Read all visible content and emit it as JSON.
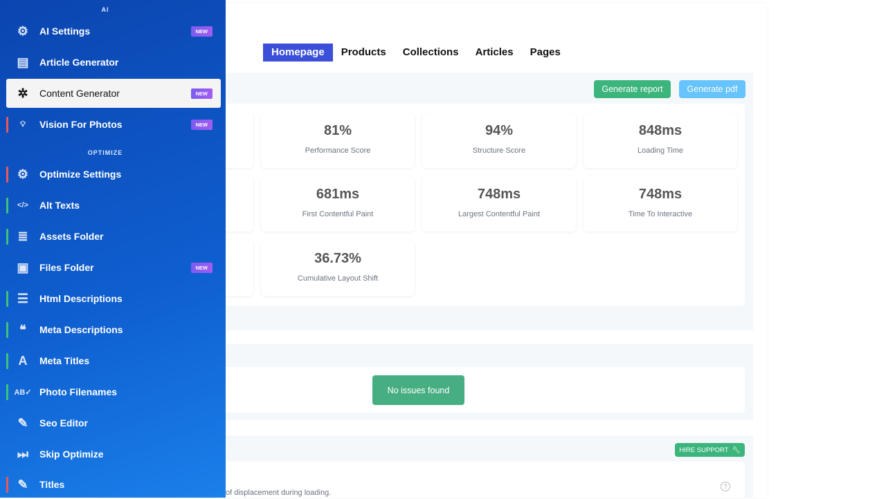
{
  "tabs": [
    {
      "label": "Homepage",
      "active": true
    },
    {
      "label": "Products"
    },
    {
      "label": "Collections"
    },
    {
      "label": "Articles"
    },
    {
      "label": "Pages"
    }
  ],
  "actions": {
    "generate_report": "Generate report",
    "generate_pdf": "Generate pdf"
  },
  "metrics": [
    {
      "value": "81%",
      "label": "Performance Score"
    },
    {
      "value": "94%",
      "label": "Structure Score"
    },
    {
      "value": "848ms",
      "label": "Loading Time"
    },
    {
      "value": "681ms",
      "label": "First Contentful Paint"
    },
    {
      "value": "748ms",
      "label": "Largest Contentful Paint"
    },
    {
      "value": "748ms",
      "label": "Time To Interactive"
    },
    {
      "value": "36.73%",
      "label": "Cumulative Layout Shift"
    }
  ],
  "issues": {
    "status": "No issues found"
  },
  "support": {
    "hire_label": "HIRE SUPPORT",
    "description_fragment": "of displacement during loading.",
    "help": "?"
  },
  "sidebar": {
    "section_ai": "AI",
    "section_optimize": "OPTIMIZE",
    "badge": "NEW",
    "items": [
      {
        "label": "AI Settings",
        "icon": "brain-gear-icon",
        "new": true
      },
      {
        "label": "Article Generator",
        "icon": "newspaper-icon"
      },
      {
        "label": "Content Generator",
        "icon": "network-icon",
        "new": true,
        "active": true
      },
      {
        "label": "Vision For Photos",
        "icon": "lightbulb-icon",
        "new": true,
        "marker": "#e85a5a"
      },
      {
        "label": "Optimize Settings",
        "icon": "cogs-icon",
        "marker": "#e85a5a"
      },
      {
        "label": "Alt Texts",
        "icon": "code-icon",
        "marker": "#3cc47c"
      },
      {
        "label": "Assets Folder",
        "icon": "stack-icon",
        "marker": "#3cc47c"
      },
      {
        "label": "Files Folder",
        "icon": "images-icon",
        "new": true
      },
      {
        "label": "Html Descriptions",
        "icon": "list-icon",
        "marker": "#3cc47c"
      },
      {
        "label": "Meta Descriptions",
        "icon": "quote-icon",
        "marker": "#3cc47c"
      },
      {
        "label": "Meta Titles",
        "icon": "font-icon",
        "marker": "#3cc47c"
      },
      {
        "label": "Photo Filenames",
        "icon": "spell-check-icon",
        "marker": "#3cc47c"
      },
      {
        "label": "Seo Editor",
        "icon": "pencil-icon"
      },
      {
        "label": "Skip Optimize",
        "icon": "skip-forward-icon"
      },
      {
        "label": "Titles",
        "icon": "edit-square-icon",
        "marker": "#e85a5a"
      }
    ]
  }
}
